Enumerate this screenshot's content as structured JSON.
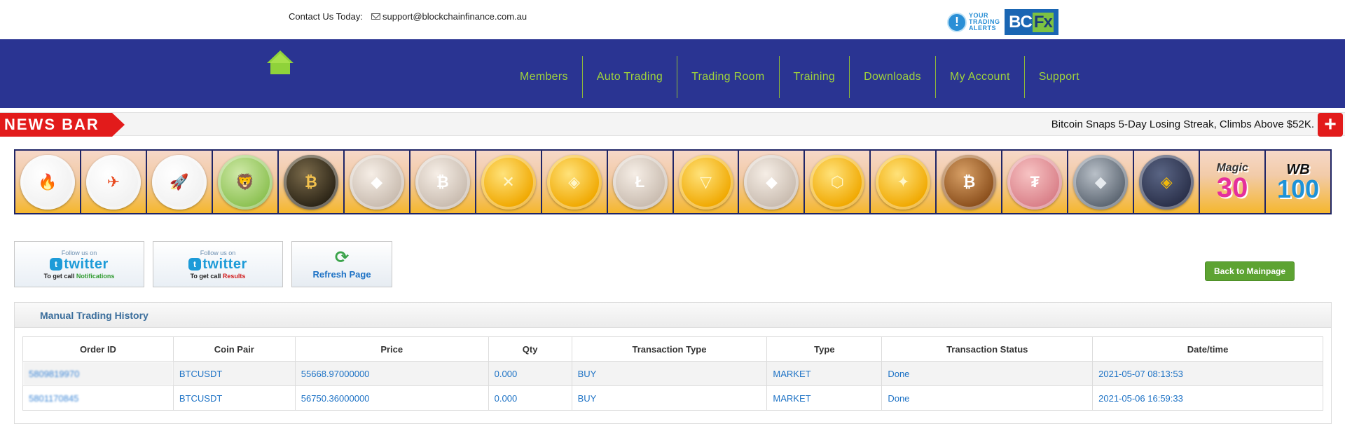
{
  "header": {
    "contact_label": "Contact Us Today:",
    "email": "support@blockchainfinance.com.au",
    "logo_yta_line1": "YOUR",
    "logo_yta_line2": "TRADING",
    "logo_yta_line3": "ALERTS",
    "logo_bcfx_bc": "BC",
    "logo_bcfx_fx": "Fx"
  },
  "nav": {
    "items": [
      {
        "label": "Members"
      },
      {
        "label": "Auto Trading"
      },
      {
        "label": "Trading Room"
      },
      {
        "label": "Training"
      },
      {
        "label": "Downloads"
      },
      {
        "label": "My Account"
      },
      {
        "label": "Support"
      }
    ],
    "color": "#9fd33b",
    "background": "#2a3492"
  },
  "news": {
    "label": "NEWS BAR",
    "headline": "Bitcoin Snaps 5-Day Losing Streak, Climbs Above $52K.",
    "plus": "+"
  },
  "coins": [
    {
      "icon": "fire-coffee-icon",
      "style": "white",
      "glyph": "🔥"
    },
    {
      "icon": "bot-hourglass-icon",
      "style": "white",
      "glyph": "✈"
    },
    {
      "icon": "rocket-icon",
      "style": "white",
      "glyph": "🚀"
    },
    {
      "icon": "lion-icon",
      "style": "green",
      "glyph": "🦁"
    },
    {
      "icon": "bitcoin-gold-icon",
      "style": "dark",
      "glyph": "₿"
    },
    {
      "icon": "ethereum-silver-icon",
      "style": "silver",
      "glyph": "◆"
    },
    {
      "icon": "bitcoin-silver-icon",
      "style": "silver",
      "glyph": "₿"
    },
    {
      "icon": "ripple-icon",
      "style": "gold",
      "glyph": "✕"
    },
    {
      "icon": "eos-icon",
      "style": "gold",
      "glyph": "◈"
    },
    {
      "icon": "litecoin-icon",
      "style": "silver",
      "glyph": "Ł"
    },
    {
      "icon": "tron-icon",
      "style": "gold",
      "glyph": "▽"
    },
    {
      "icon": "ethereum-classic-icon",
      "style": "silver",
      "glyph": "◆"
    },
    {
      "icon": "chainlink-icon",
      "style": "gold",
      "glyph": "⬡"
    },
    {
      "icon": "stellar-icon",
      "style": "gold",
      "glyph": "✦"
    },
    {
      "icon": "bitcoin-bronze-icon",
      "style": "bronze",
      "glyph": "₿"
    },
    {
      "icon": "tether-icon",
      "style": "pink",
      "glyph": "₮"
    },
    {
      "icon": "ethereum-grey-icon",
      "style": "grey",
      "glyph": "◆"
    },
    {
      "icon": "binance-icon",
      "style": "navy",
      "glyph": "◈"
    }
  ],
  "promo": {
    "magic_top": "Magic",
    "magic_num": "30",
    "wb_top": "WB",
    "wb_num": "100"
  },
  "buttons": {
    "follow_small": "Follow us on",
    "follow_brand": "twitter",
    "follow1_prefix": "To get call",
    "follow1_suffix": "Notifications",
    "follow2_prefix": "To get call",
    "follow2_suffix": "Results",
    "refresh_label": "Refresh Page",
    "back_label": "Back to Mainpage"
  },
  "history": {
    "title": "Manual Trading History",
    "columns": [
      "Order ID",
      "Coin Pair",
      "Price",
      "Qty",
      "Transaction Type",
      "Type",
      "Transaction Status",
      "Date/time"
    ],
    "rows": [
      [
        "5809819970",
        "BTCUSDT",
        "55668.97000000",
        "0.000",
        "BUY",
        "MARKET",
        "Done",
        "2021-05-07 08:13:53"
      ],
      [
        "5801170845",
        "BTCUSDT",
        "56750.36000000",
        "0.000",
        "BUY",
        "MARKET",
        "Done",
        "2021-05-06 16:59:33"
      ]
    ]
  }
}
